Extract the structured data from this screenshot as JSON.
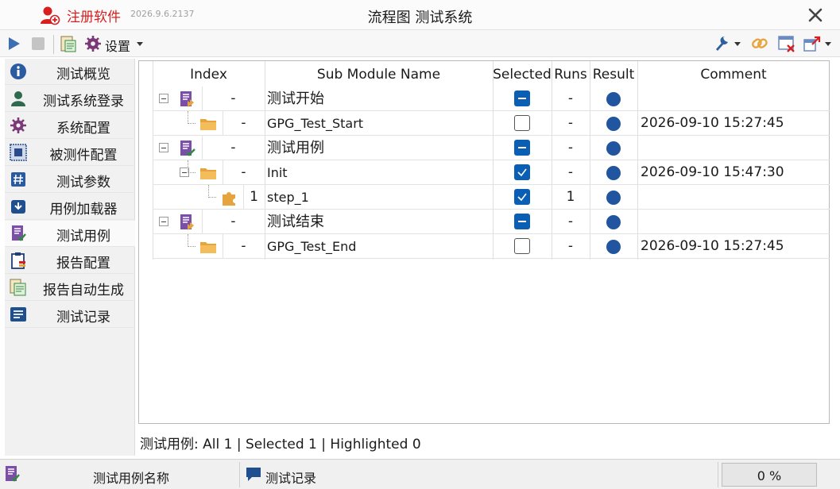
{
  "titlebar": {
    "register_label": "注册软件",
    "version": "2026.9.6.2137",
    "title": "流程图 测试系统"
  },
  "toolbar": {
    "settings_label": "设置"
  },
  "sidebar": {
    "items": [
      {
        "label": "测试概览",
        "icon": "info-icon"
      },
      {
        "label": "测试系统登录",
        "icon": "user-icon"
      },
      {
        "label": "系统配置",
        "icon": "gear-icon"
      },
      {
        "label": "被测件配置",
        "icon": "chip-icon"
      },
      {
        "label": "测试参数",
        "icon": "hash-icon"
      },
      {
        "label": "用例加载器",
        "icon": "download-icon"
      },
      {
        "label": "测试用例",
        "icon": "checklist-icon"
      },
      {
        "label": "报告配置",
        "icon": "clipboard-icon"
      },
      {
        "label": "报告自动生成",
        "icon": "report-icon"
      },
      {
        "label": "测试记录",
        "icon": "notes-icon"
      }
    ]
  },
  "grid": {
    "columns": [
      "Index",
      "Sub Module Name",
      "Selected",
      "Runs",
      "Result",
      "Comment"
    ],
    "rows": [
      {
        "index": "-",
        "name": "测试开始",
        "selected": "partial",
        "runs": "-",
        "result_color": "#2255a0",
        "comment": "",
        "level": 0,
        "icon": "module-icon",
        "expander": true
      },
      {
        "index": "-",
        "name": "GPG_Test_Start",
        "selected": "unchecked",
        "runs": "-",
        "result_color": "#2255a0",
        "comment": "2026-09-10 15:27:45",
        "level": 1,
        "icon": "folder-icon",
        "expander": false
      },
      {
        "index": "-",
        "name": "测试用例",
        "selected": "partial",
        "runs": "-",
        "result_color": "#2255a0",
        "comment": "",
        "level": 0,
        "icon": "testcase-icon",
        "expander": true
      },
      {
        "index": "-",
        "name": "Init",
        "selected": "checked",
        "runs": "-",
        "result_color": "#2255a0",
        "comment": "2026-09-10 15:47:30",
        "level": 1,
        "icon": "folder-icon",
        "expander": true
      },
      {
        "index": "1",
        "name": "step_1",
        "selected": "checked",
        "runs": "1",
        "result_color": "#2255a0",
        "comment": "",
        "level": 2,
        "icon": "puzzle-icon",
        "expander": false
      },
      {
        "index": "-",
        "name": "测试结束",
        "selected": "partial",
        "runs": "-",
        "result_color": "#2255a0",
        "comment": "",
        "level": 0,
        "icon": "module-icon",
        "expander": true
      },
      {
        "index": "-",
        "name": "GPG_Test_End",
        "selected": "unchecked",
        "runs": "-",
        "result_color": "#2255a0",
        "comment": "2026-09-10 15:27:45",
        "level": 1,
        "icon": "folder-icon",
        "expander": false
      }
    ]
  },
  "status_line": "测试用例: All 1 | Selected 1 | Highlighted 0",
  "statusbar": {
    "case_name_label": "测试用例名称",
    "log_label": "测试记录",
    "progress_text": "0 %",
    "progress_value": 0
  },
  "colors": {
    "accent": "#0a5fb4",
    "result_dot": "#2255a0",
    "register_red": "#d81e1e",
    "folder": "#e8a43c",
    "module_purple": "#7b4fa8"
  }
}
